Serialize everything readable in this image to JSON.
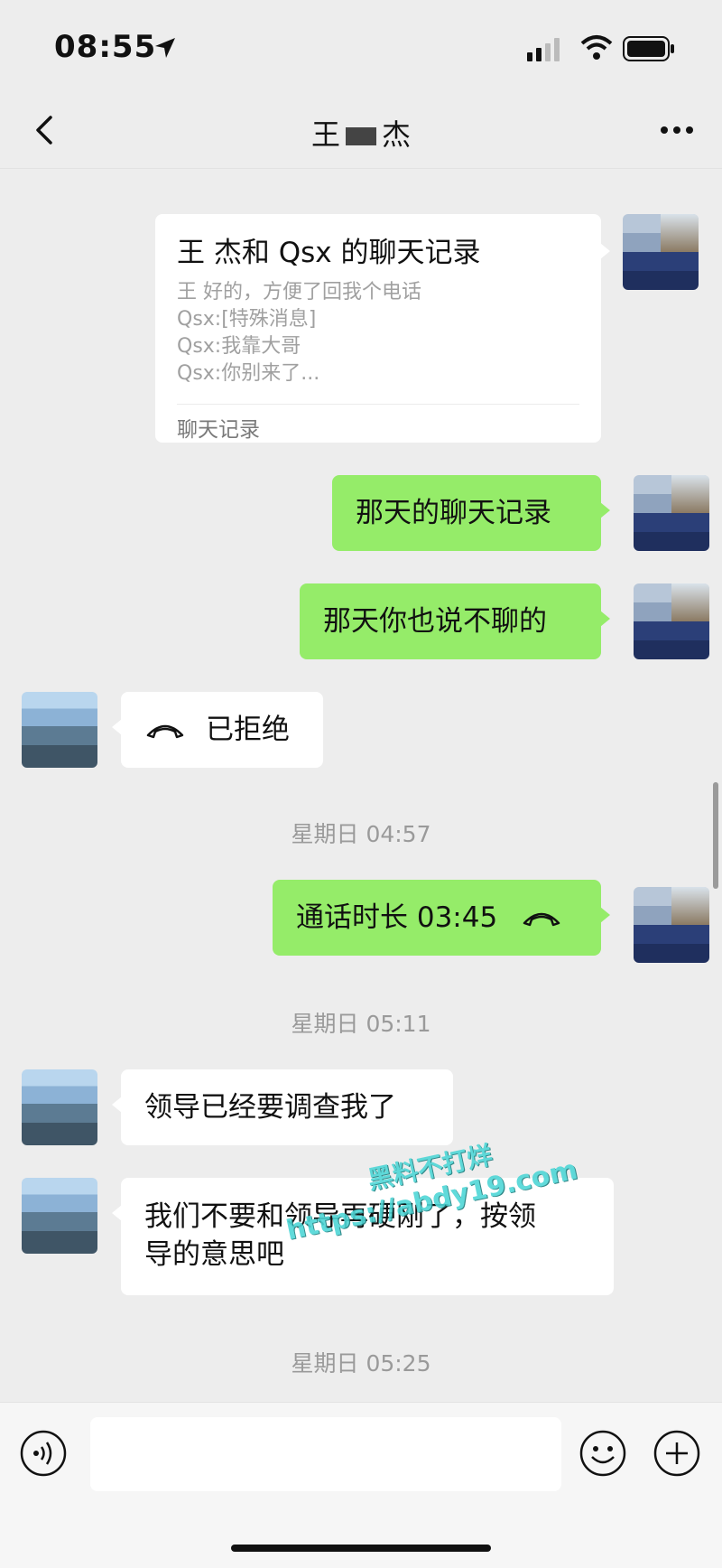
{
  "status": {
    "time": "08:55"
  },
  "nav": {
    "title_left": "王",
    "title_right": "杰"
  },
  "timestamps": [
    "星期日 04:57",
    "星期日 05:11",
    "星期日 05:25"
  ],
  "record": {
    "title": "王  杰和 Qsx 的聊天记录",
    "lines": [
      "王    好的，方便了回我个电话",
      "Qsx:[特殊消息]",
      "Qsx:我靠大哥",
      "Qsx:你别来了..."
    ],
    "footer": "聊天记录"
  },
  "messages": {
    "m1": "那天的聊天记录",
    "m2": "那天你也说不聊的",
    "m3": "已拒绝",
    "m4": "通话时长 03:45",
    "m5": "领导已经要调查我了",
    "m6_line1": "我们不要和领导再硬刚了，按领",
    "m6_line2": "导的意思吧"
  },
  "watermark": {
    "line1": "黑料不打烊",
    "line2": "https://abdy19.com"
  },
  "colors": {
    "green": "#95ec69",
    "background": "#ededed",
    "white": "#ffffff"
  },
  "icons": [
    "back-icon",
    "more-icon",
    "call-icon",
    "voice-icon",
    "emoji-icon",
    "plus-icon",
    "location-icon",
    "signal-icon",
    "wifi-icon",
    "battery-icon"
  ]
}
